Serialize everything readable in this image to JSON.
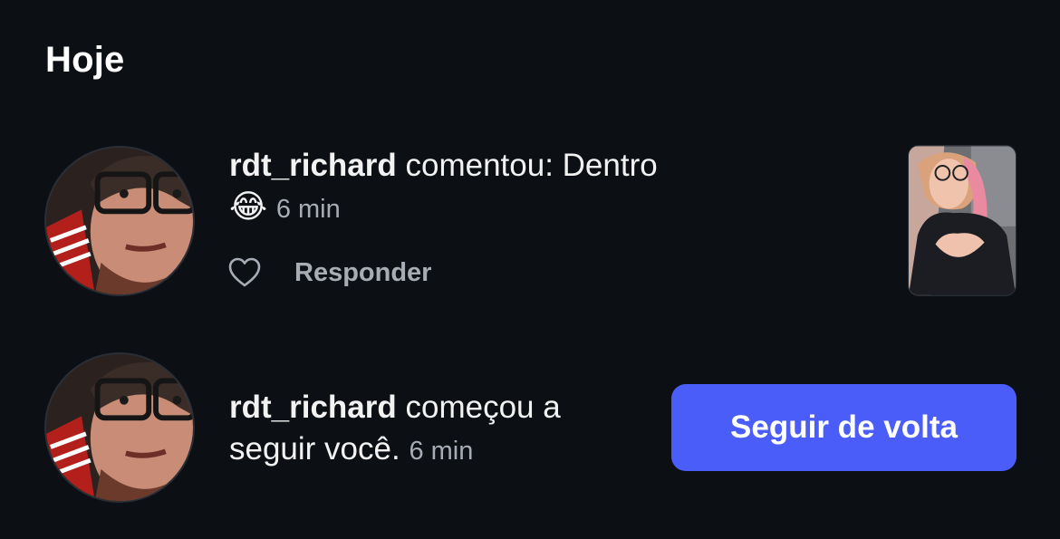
{
  "section": {
    "title": "Hoje"
  },
  "notifications": [
    {
      "username": "rdt_richard",
      "action": " comentou: Dentro",
      "emoji": "😂",
      "time": "6 min",
      "reply_label": "Responder"
    },
    {
      "username": "rdt_richard",
      "action": " começou a seguir você.",
      "time": "6 min",
      "follow_label": "Seguir de volta"
    }
  ],
  "colors": {
    "background": "#0c0f14",
    "accent": "#4a5df9",
    "secondary_text": "#a7acb5"
  }
}
